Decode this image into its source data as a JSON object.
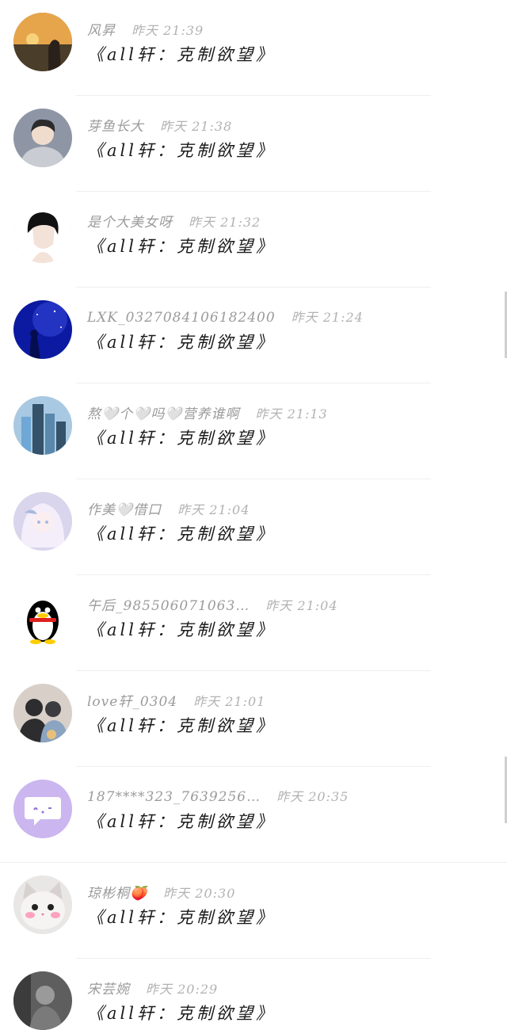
{
  "comments": [
    {
      "name": "风昇",
      "time": "昨天 21:39",
      "text": "《all轩：克制欲望》",
      "avatar": "sunset-avatar",
      "colors": [
        "#4a3d2a",
        "#e6a54b",
        "#a07d5b"
      ]
    },
    {
      "name": "芽鱼长大",
      "time": "昨天 21:38",
      "text": "《all轩：克制欲望》",
      "avatar": "hoodie-boy-avatar",
      "colors": [
        "#2b2b2b",
        "#c9ccd2",
        "#f0dccd"
      ]
    },
    {
      "name": "是个大美女呀",
      "time": "昨天 21:32",
      "text": "《all轩：克制欲望》",
      "avatar": "anime-boy-avatar",
      "colors": [
        "#111111",
        "#f3e2d8",
        "#ffffff"
      ]
    },
    {
      "name": "LXK_0327084106182400",
      "time": "昨天 21:24",
      "text": "《all轩：克制欲望》",
      "avatar": "starry-night-avatar",
      "colors": [
        "#0b1aa0",
        "#3345d8",
        "#050d50"
      ]
    },
    {
      "name": "熬🤍个🤍吗🤍营养谁啊",
      "time": "昨天 21:13",
      "text": "《all轩：克制欲望》",
      "avatar": "city-buildings-avatar",
      "colors": [
        "#6fa8d6",
        "#34526a",
        "#a9c9e2"
      ]
    },
    {
      "name": "作美🤍借口",
      "time": "昨天 21:04",
      "text": "《all轩：克制欲望》",
      "avatar": "anime-girl-avatar",
      "colors": [
        "#d8d5ec",
        "#a8b9e0",
        "#f4eefa"
      ]
    },
    {
      "name": "午后_985506071063…",
      "time": "昨天 21:04",
      "text": "《all轩：克制欲望》",
      "avatar": "penguin-avatar",
      "colors": [
        "#000000",
        "#ffcc00",
        "#e02020"
      ]
    },
    {
      "name": "love轩_0304",
      "time": "昨天 21:01",
      "text": "《all轩：克制欲望》",
      "avatar": "couple-avatar",
      "colors": [
        "#2d2d30",
        "#d8d0c8",
        "#8aa4c2"
      ]
    },
    {
      "name": "187****323_7639256…",
      "time": "昨天 20:35",
      "text": "《all轩：克制欲望》",
      "avatar": "chat-bubble-avatar",
      "colors": [
        "#cbb6f0",
        "#ffffff",
        "#8f70d6"
      ]
    },
    {
      "name": "琼彬桐🍑",
      "time": "昨天 20:30",
      "text": "《all轩：克制欲望》",
      "avatar": "cat-avatar",
      "colors": [
        "#e9e7e6",
        "#ff8fb0",
        "#bdb7b2"
      ]
    },
    {
      "name": "宋芸婉",
      "time": "昨天 20:29",
      "text": "《all轩：克制欲望》",
      "avatar": "dark-photo-avatar",
      "colors": [
        "#3c3c3c",
        "#9a9a9a",
        "#5e5e5e"
      ]
    }
  ]
}
